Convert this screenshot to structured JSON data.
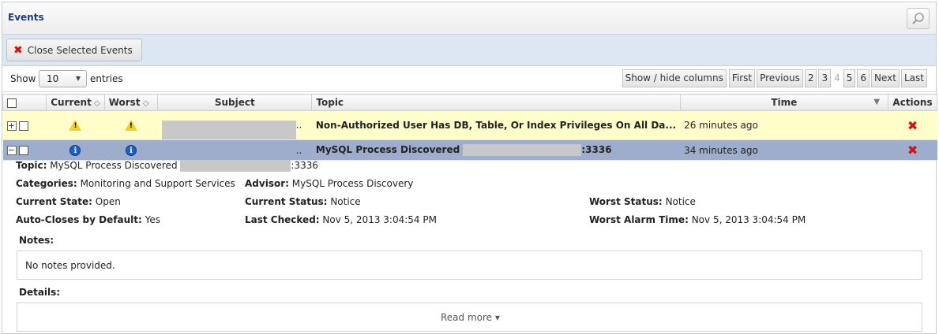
{
  "header": {
    "title": "Events"
  },
  "toolbar": {
    "close_selected_label": "Close Selected Events"
  },
  "controls": {
    "show_label": "Show",
    "page_size": "10",
    "entries_label": "entries",
    "pager": {
      "show_hide": "Show / hide columns",
      "first": "First",
      "previous": "Previous",
      "pages": [
        "2",
        "3",
        "4",
        "5",
        "6"
      ],
      "current_page": "4",
      "next": "Next",
      "last": "Last"
    }
  },
  "table": {
    "columns": {
      "current": "Current",
      "worst": "Worst",
      "subject": "Subject",
      "topic": "Topic",
      "time": "Time",
      "actions": "Actions"
    },
    "rows": [
      {
        "expander": "+",
        "current_icon": "warning-icon",
        "worst_icon": "warning-icon",
        "subject_suffix": "..",
        "topic": "Non-Authorized User Has DB, Table, Or Index Privileges On All Da...",
        "time": "26 minutes ago"
      },
      {
        "expander": "−",
        "current_icon": "info-icon",
        "worst_icon": "info-icon",
        "subject_suffix": "..",
        "topic_prefix": "MySQL Process Discovered",
        "topic_suffix": ":3336",
        "time": "34 minutes ago"
      }
    ]
  },
  "detail": {
    "topic_label": "Topic:",
    "topic_prefix": "MySQL Process Discovered",
    "topic_suffix": ":3336",
    "categories_label": "Categories:",
    "categories": "Monitoring and Support Services",
    "advisor_label": "Advisor:",
    "advisor": "MySQL Process Discovery",
    "current_state_label": "Current State:",
    "current_state": "Open",
    "current_status_label": "Current Status:",
    "current_status": "Notice",
    "worst_status_label": "Worst Status:",
    "worst_status": "Notice",
    "auto_closes_label": "Auto-Closes by Default:",
    "auto_closes": "Yes",
    "last_checked_label": "Last Checked:",
    "last_checked": "Nov 5, 2013 3:04:54 PM",
    "worst_alarm_label": "Worst Alarm Time:",
    "worst_alarm": "Nov 5, 2013 3:04:54 PM",
    "notes_label": "Notes:",
    "notes": "No notes provided.",
    "details_label": "Details:",
    "read_more": "Read more ▾"
  },
  "colors": {
    "warn_row": "#fffdc9",
    "selected_row": "#9eadcc",
    "close_red": "#d41313",
    "title_blue": "#1c3f73"
  }
}
